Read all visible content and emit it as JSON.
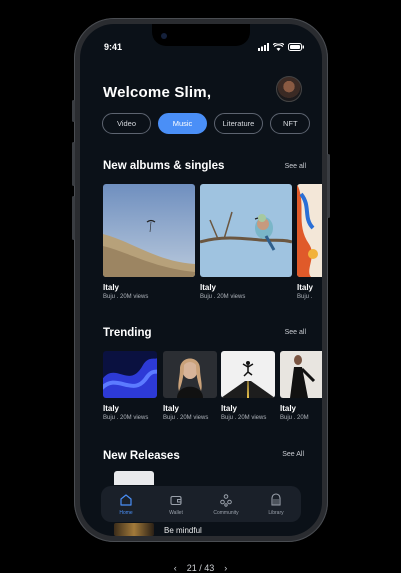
{
  "status": {
    "time": "9:41"
  },
  "header": {
    "welcome": "Welcome Slim,"
  },
  "chips": [
    "Video",
    "Music",
    "Literature",
    "NFT"
  ],
  "albums": {
    "title": "New albums & singles",
    "see_all": "See all",
    "items": [
      {
        "title": "Italy",
        "subtitle": "Buju . 20M views"
      },
      {
        "title": "Italy",
        "subtitle": "Buju . 20M views"
      },
      {
        "title": "Italy",
        "subtitle": "Buju ."
      }
    ]
  },
  "trending": {
    "title": "Trending",
    "see_all": "See all",
    "items": [
      {
        "title": "Italy",
        "subtitle": "Buju . 20M views"
      },
      {
        "title": "Italy",
        "subtitle": "Buju . 20M views"
      },
      {
        "title": "Italy",
        "subtitle": "Buju . 20M views"
      },
      {
        "title": "Italy",
        "subtitle": "Buju . 20M"
      }
    ]
  },
  "releases": {
    "title": "New Releases",
    "see_all": "See All",
    "item_label": "Be mindful"
  },
  "tabbar": [
    {
      "label": "Home",
      "icon": "home-icon"
    },
    {
      "label": "Wallet",
      "icon": "wallet-icon"
    },
    {
      "label": "Community",
      "icon": "community-icon"
    },
    {
      "label": "Library",
      "icon": "library-icon"
    }
  ],
  "pager": {
    "text": "21 / 43",
    "prev": "‹",
    "next": "›"
  },
  "colors": {
    "accent": "#4a8ff7",
    "background": "#0b1118",
    "tabbar": "#1a2029"
  }
}
